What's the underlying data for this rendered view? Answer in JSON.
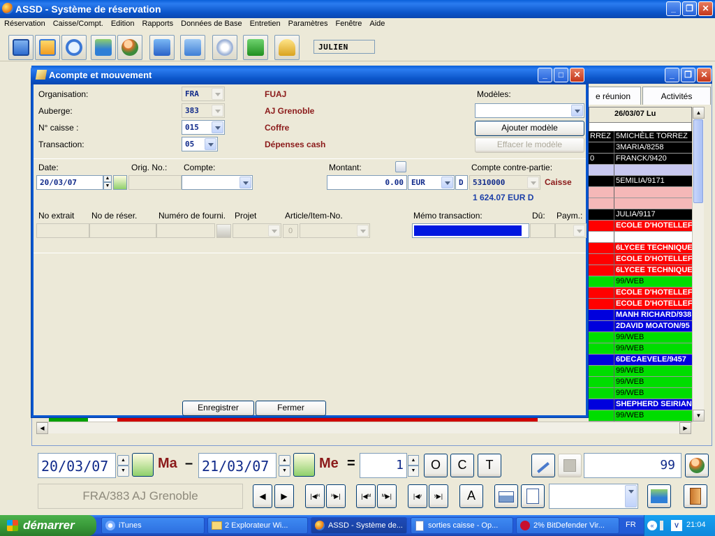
{
  "app": {
    "title": "ASSD - Système de réservation"
  },
  "menu": [
    "Réservation",
    "Caisse/Compt.",
    "Edition",
    "Rapports",
    "Données de Base",
    "Entretien",
    "Paramètres",
    "Fenêtre",
    "Aide"
  ],
  "toolbar": {
    "user": "JULIEN"
  },
  "background_window": {
    "tabs": [
      "e réunion",
      "Activités"
    ],
    "column_header": "26/03/07 Lu",
    "rows": [
      {
        "left": "RREZ",
        "text": "5MICHÈLE TORREZ",
        "color": "#000000",
        "fg": "#ffffff"
      },
      {
        "left": "",
        "text": "3MARIA/8258",
        "color": "#000000",
        "fg": "#ffffff"
      },
      {
        "left": "0",
        "text": "FRANCK/9420",
        "color": "#000000",
        "fg": "#ffffff"
      },
      {
        "left": "",
        "text": "",
        "color": "#c8c8f0",
        "fg": "#000000"
      },
      {
        "left": "",
        "text": "5EMILIA/9171",
        "color": "#000000",
        "fg": "#ffffff"
      },
      {
        "left": "",
        "text": "",
        "color": "#f5b8b8",
        "fg": "#000000"
      },
      {
        "left": "",
        "text": "",
        "color": "#f5b8b8",
        "fg": "#000000"
      },
      {
        "left": "",
        "text": "JULIA/9117",
        "color": "#000000",
        "fg": "#ffffff"
      },
      {
        "left": "",
        "text": "ECOLE D'HOTELLEF",
        "color": "#ff0000",
        "fg": "#ffffff"
      },
      {
        "left": "",
        "text": "",
        "color": "#ffffff",
        "fg": "#000000"
      },
      {
        "left": "",
        "text": "6LYCEE TECHNIQUE",
        "color": "#ff0000",
        "fg": "#ffffff"
      },
      {
        "left": "",
        "text": "ECOLE D'HOTELLEF",
        "color": "#ff0000",
        "fg": "#ffffff"
      },
      {
        "left": "",
        "text": "6LYCEE TECHNIQUE",
        "color": "#ff0000",
        "fg": "#ffffff"
      },
      {
        "left": "",
        "text": "99/WEB",
        "color": "#00dd00",
        "fg": "#000000"
      },
      {
        "left": "",
        "text": "ECOLE D'HOTELLEF",
        "color": "#ff0000",
        "fg": "#ffffff"
      },
      {
        "left": "",
        "text": "ECOLE D'HOTELLEF",
        "color": "#ff0000",
        "fg": "#ffffff"
      },
      {
        "left": "",
        "text": "MANH RICHARD/938",
        "color": "#0000dd",
        "fg": "#ffffff"
      },
      {
        "left": "",
        "text": "2DAVID MOATON/95",
        "color": "#0000dd",
        "fg": "#ffffff"
      },
      {
        "left": "",
        "text": "99/WEB",
        "color": "#00dd00",
        "fg": "#000000"
      },
      {
        "left": "",
        "text": "99/WEB",
        "color": "#00dd00",
        "fg": "#000000"
      },
      {
        "left": "",
        "text": "6DECAEVELE/9457",
        "color": "#0000dd",
        "fg": "#ffffff"
      },
      {
        "left": "",
        "text": "99/WEB",
        "color": "#00dd00",
        "fg": "#000000"
      },
      {
        "left": "",
        "text": "99/WEB",
        "color": "#00dd00",
        "fg": "#000000"
      },
      {
        "left": "",
        "text": "99/WEB",
        "color": "#00dd00",
        "fg": "#000000"
      },
      {
        "left": "",
        "text": "SHEPHERD SEIRIAN",
        "color": "#0000dd",
        "fg": "#ffffff"
      },
      {
        "left": "",
        "text": "99/WEB",
        "color": "#00dd00",
        "fg": "#000000"
      }
    ]
  },
  "dialog": {
    "title": "Acompte et mouvement",
    "labels": {
      "organisation": "Organisation:",
      "auberge": "Auberge:",
      "caisse": "N° caisse :",
      "transaction": "Transaction:",
      "modeles": "Modèles:",
      "date": "Date:",
      "orig_no": "Orig. No.:",
      "compte": "Compte:",
      "montant": "Montant:",
      "contre_partie": "Compte contre-partie:",
      "no_extrait": "No extrait",
      "no_reser": "No de réser.",
      "numero_fourni": "Numéro de fourni.",
      "projet": "Projet",
      "article": "Article/Item-No.",
      "memo": "Mémo transaction:",
      "du": "Dû:",
      "paym": "Paym.:"
    },
    "values": {
      "organisation": "FRA",
      "auberge": "383",
      "caisse": "015",
      "transaction": "05",
      "organisation_name": "FUAJ",
      "auberge_name": "AJ Grenoble",
      "caisse_name": "Coffre",
      "transaction_name": "Dépenses cash",
      "date": "20/03/07",
      "montant": "0.00",
      "currency": "EUR",
      "dc": "D",
      "contre_partie": "5310000",
      "contre_partie_name": "Caisse",
      "balance": "1 624.07 EUR D",
      "article_prefix": "0"
    },
    "buttons": {
      "ajouter": "Ajouter modèle",
      "effacer": "Effacer le modèle",
      "enregistrer": "Enregistrer",
      "fermer": "Fermer"
    }
  },
  "bottom": {
    "date_from": "20/03/07",
    "day_from": "Ma",
    "dash": "–",
    "date_to": "21/03/07",
    "day_to": "Me",
    "equals": "=",
    "nights": "1",
    "btn_o": "O",
    "btn_c": "C",
    "btn_t": "T",
    "count": "99",
    "hostel": "FRA/383 AJ Grenoble",
    "btn_a": "A"
  },
  "taskbar": {
    "start": "démarrer",
    "tasks": [
      "iTunes",
      "2 Explorateur Wi...",
      "ASSD - Système de...",
      "sorties caisse - Op...",
      "2% BitDefender Vir..."
    ],
    "lang": "FR",
    "clock": "21:04"
  }
}
